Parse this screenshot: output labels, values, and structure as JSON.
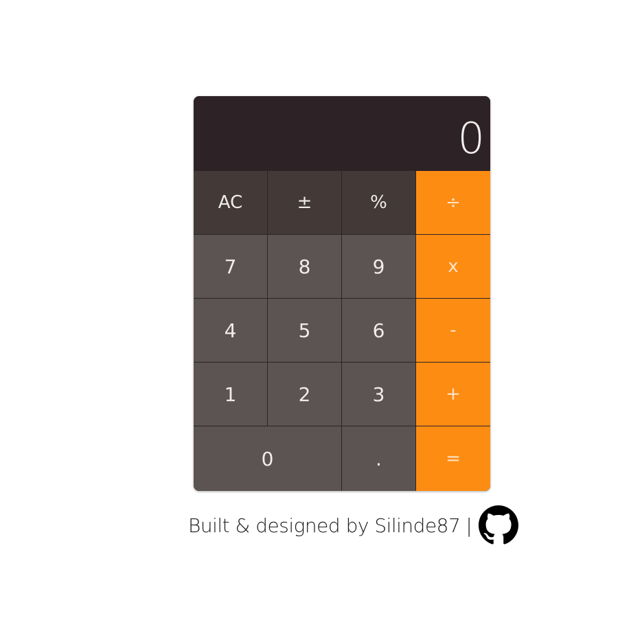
{
  "display": {
    "value": "0"
  },
  "keys": {
    "ac": "AC",
    "plus_minus": "±",
    "percent": "%",
    "divide": "÷",
    "seven": "7",
    "eight": "8",
    "nine": "9",
    "multiply": "x",
    "four": "4",
    "five": "5",
    "six": "6",
    "minus": "-",
    "one": "1",
    "two": "2",
    "three": "3",
    "plus": "+",
    "zero": "0",
    "decimal": ".",
    "equals": "="
  },
  "footer": {
    "text": "Built & designed by Silinde87",
    "separator": "|",
    "icon": "github-icon"
  },
  "colors": {
    "display_bg": "#2d2327",
    "function_key": "#433a38",
    "digit_key": "#5c5452",
    "operator_key": "#fd8c13",
    "key_text": "#f0ece9"
  }
}
